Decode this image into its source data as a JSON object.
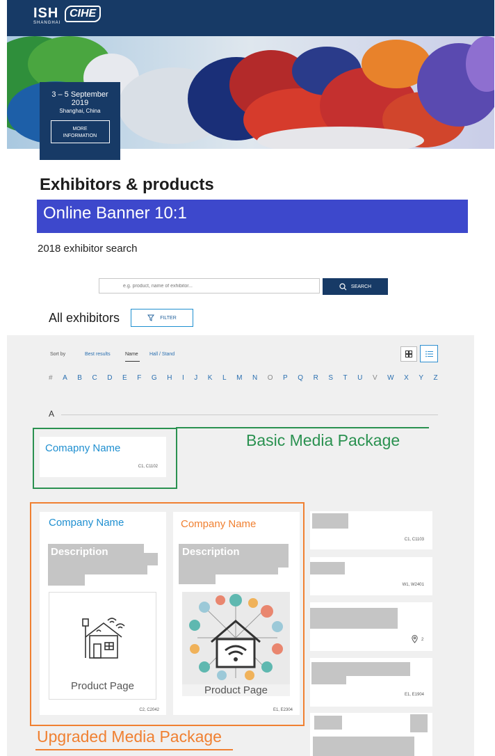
{
  "header": {
    "logo_ish": "ISH",
    "logo_ish_sub": "SHANGHAI",
    "logo_cihe": "CIHE"
  },
  "event": {
    "dates": "3 – 5 September",
    "year": "2019",
    "location": "Shanghai, China",
    "more_line1": "MORE",
    "more_line2": "INFORMATION"
  },
  "page_title": "Exhibitors & products",
  "banner_label": "Online Banner 10:1",
  "search": {
    "title": "2018 exhibitor search",
    "placeholder": "e.g. product, name of exhibitor...",
    "button": "SEARCH"
  },
  "all_exhibitors": "All exhibitors",
  "filter_button": "FILTER",
  "sort": {
    "label": "Sort by",
    "options": [
      "Best results",
      "Name",
      "Hall / Stand"
    ],
    "active": "Name"
  },
  "alphabet": [
    "#",
    "A",
    "B",
    "C",
    "D",
    "E",
    "F",
    "G",
    "H",
    "I",
    "J",
    "K",
    "L",
    "M",
    "N",
    "O",
    "P",
    "Q",
    "R",
    "S",
    "T",
    "U",
    "V",
    "W",
    "X",
    "Y",
    "Z"
  ],
  "section_letter": "A",
  "basic": {
    "label": "Basic Media Package",
    "card_name": "Comapny Name",
    "card_stand": "C1, C1102"
  },
  "upgraded": {
    "label": "Upgraded Media Package",
    "card1": {
      "name": "Company Name",
      "description": "Description",
      "product": "Product Page",
      "stand": "C2, C2042"
    },
    "card2": {
      "name": "Company Name",
      "description": "Description",
      "product": "Product Page",
      "stand": "E1, E2304"
    }
  },
  "right_cards": {
    "stand1": "C1, C1103",
    "stand2": "W1, W2401",
    "count3": "2",
    "stand4": "E1, E1904"
  },
  "colors": {
    "navy": "#173a66",
    "banner_blue": "#3d48cc",
    "green": "#2a9150",
    "orange": "#f08031",
    "link_blue": "#1f8fd0"
  }
}
